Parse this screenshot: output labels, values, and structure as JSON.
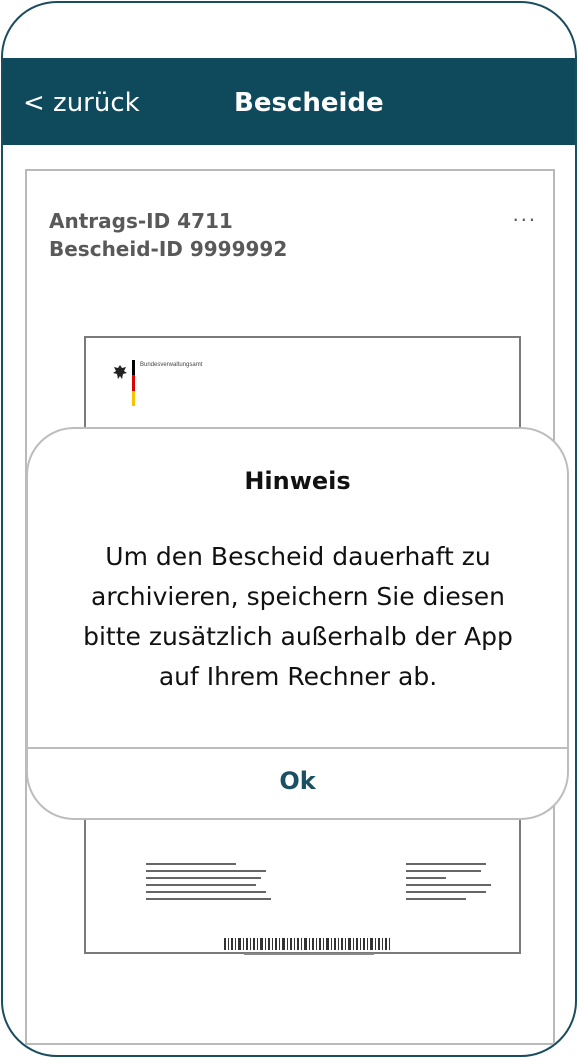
{
  "header": {
    "back_label": "< zurück",
    "title": "Bescheide"
  },
  "card": {
    "antrag_id": "Antrags-ID 4711",
    "bescheid_id": "Bescheid-ID 9999992",
    "menu": "...",
    "document": {
      "authority": "Bundesverwaltungsamt"
    }
  },
  "dialog": {
    "title": "Hinweis",
    "message": "Um den Bescheid dauerhaft zu archivieren, speichern Sie diesen bitte zusätzlich außerhalb der App auf Ihrem Rechner ab.",
    "ok": "Ok"
  },
  "colors": {
    "header_bg": "#0f4a5c",
    "accent": "#1b4f63"
  }
}
